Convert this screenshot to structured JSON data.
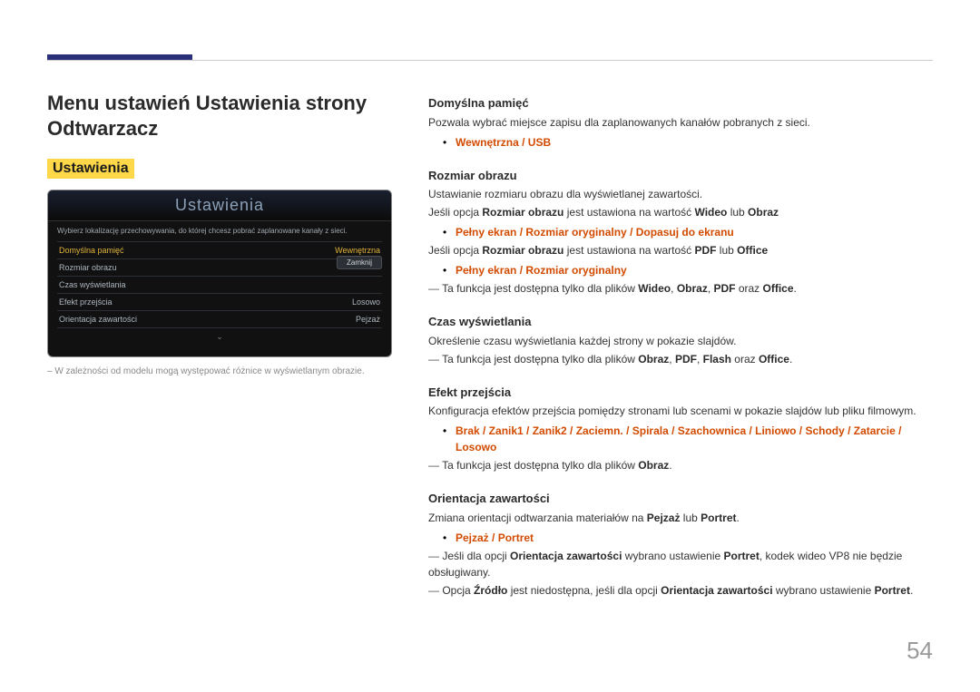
{
  "page_number": "54",
  "left": {
    "title": "Menu ustawień Ustawienia strony Odtwarzacz",
    "section_label": "Ustawienia",
    "mock": {
      "header": "Ustawienia",
      "desc": "Wybierz lokalizację przechowywania, do której chcesz pobrać zaplanowane kanały z sieci.",
      "rows": [
        {
          "label": "Domyślna pamięć",
          "value": "Wewnętrzna",
          "selected": true
        },
        {
          "label": "Rozmiar obrazu",
          "value": "",
          "selected": false
        },
        {
          "label": "Czas wyświetlania",
          "value": "",
          "selected": false
        },
        {
          "label": "Efekt przejścia",
          "value": "Losowo",
          "selected": false
        },
        {
          "label": "Orientacja zawartości",
          "value": "Pejzaż",
          "selected": false
        }
      ],
      "close": "Zamknij"
    },
    "note": "W zależności od modelu mogą występować różnice w wyświetlanym obrazie."
  },
  "right": {
    "s1": {
      "title": "Domyślna pamięć",
      "desc": "Pozwala wybrać miejsce zapisu dla zaplanowanych kanałów pobranych z sieci.",
      "opt": "Wewnętrzna / USB"
    },
    "s2": {
      "title": "Rozmiar obrazu",
      "desc": "Ustawianie rozmiaru obrazu dla wyświetlanej zawartości.",
      "cond1_a": "Jeśli opcja ",
      "cond1_b": "Rozmiar obrazu",
      "cond1_c": " jest ustawiona na wartość ",
      "cond1_d": "Wideo",
      "cond1_e": " lub ",
      "cond1_f": "Obraz",
      "opt1": "Pełny ekran / Rozmiar oryginalny / Dopasuj do ekranu",
      "cond2_a": "Jeśli opcja ",
      "cond2_b": "Rozmiar obrazu",
      "cond2_c": " jest ustawiona na wartość ",
      "cond2_d": "PDF",
      "cond2_e": " lub ",
      "cond2_f": "Office",
      "opt2": "Pełny ekran / Rozmiar oryginalny",
      "note_a": "Ta funkcja jest dostępna tylko dla plików ",
      "note_b": "Wideo",
      "note_c": ", ",
      "note_d": "Obraz",
      "note_e": ", ",
      "note_f": "PDF",
      "note_g": " oraz ",
      "note_h": "Office",
      "note_i": "."
    },
    "s3": {
      "title": "Czas wyświetlania",
      "desc": "Określenie czasu wyświetlania każdej strony w pokazie slajdów.",
      "note_a": "Ta funkcja jest dostępna tylko dla plików ",
      "note_b": "Obraz",
      "note_c": ", ",
      "note_d": "PDF",
      "note_e": ", ",
      "note_f": "Flash",
      "note_g": " oraz ",
      "note_h": "Office",
      "note_i": "."
    },
    "s4": {
      "title": "Efekt przejścia",
      "desc": "Konfiguracja efektów przejścia pomiędzy stronami lub scenami w pokazie slajdów lub pliku filmowym.",
      "opt": "Brak / Zanik1 / Zanik2 / Zaciemn. / Spirala / Szachownica / Liniowo / Schody / Zatarcie / Losowo",
      "note_a": "Ta funkcja jest dostępna tylko dla plików ",
      "note_b": "Obraz",
      "note_c": "."
    },
    "s5": {
      "title": "Orientacja zawartości",
      "d_a": "Zmiana orientacji odtwarzania materiałów na ",
      "d_b": "Pejzaż",
      "d_c": " lub ",
      "d_d": "Portret",
      "d_e": ".",
      "opt": "Pejzaż / Portret",
      "n1_a": "Jeśli dla opcji ",
      "n1_b": "Orientacja zawartości",
      "n1_c": " wybrano ustawienie ",
      "n1_d": "Portret",
      "n1_e": ", kodek wideo VP8 nie będzie obsługiwany.",
      "n2_a": "Opcja ",
      "n2_b": "Źródło",
      "n2_c": " jest niedostępna, jeśli dla opcji ",
      "n2_d": "Orientacja zawartości",
      "n2_e": " wybrano ustawienie ",
      "n2_f": "Portret",
      "n2_g": "."
    }
  }
}
